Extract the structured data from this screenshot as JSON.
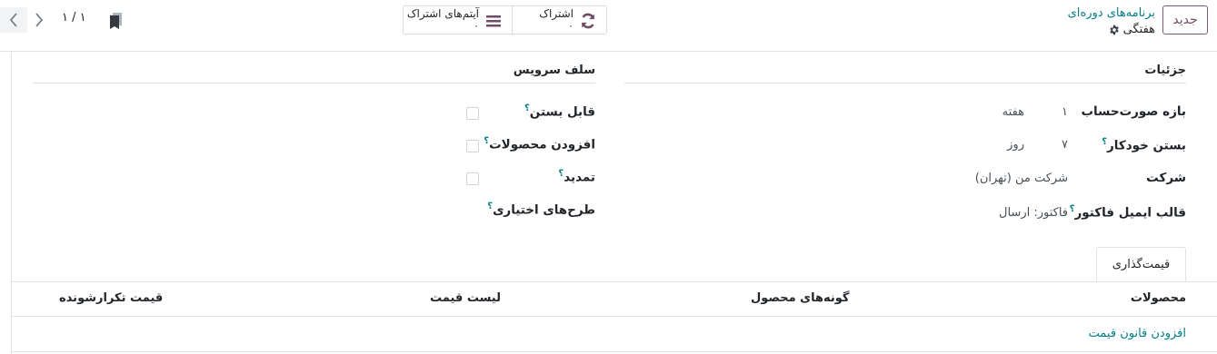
{
  "header": {
    "new_button": "جدید",
    "breadcrumb_parent": "برنامه‌های دوره‌ای",
    "breadcrumb_current": "هفتگی"
  },
  "smart_buttons": {
    "subscriptions": {
      "label": "اشتراک",
      "value": "۰"
    },
    "subscription_items": {
      "label": "آیتم‌های اشتراک",
      "value": "۰"
    }
  },
  "pager": {
    "value": "۱ / ۱"
  },
  "details": {
    "title": "جزئیات",
    "billing_period": {
      "label": "بازه صورت‌حساب",
      "number": "۱",
      "unit": "هفته"
    },
    "auto_close": {
      "label": "بستن خودکار",
      "help": "؟",
      "number": "۷",
      "unit": "روز"
    },
    "company": {
      "label": "شرکت",
      "value": "شرکت من (تهران)"
    },
    "invoice_email_template": {
      "label": "قالب ایمیل فاکتور",
      "help": "؟",
      "value": "فاکتور: ارسال"
    }
  },
  "self_service": {
    "title": "سلف سرویس",
    "closable": {
      "label": "قابل بستن",
      "help": "؟"
    },
    "add_products": {
      "label": "افزودن محصولات",
      "help": "؟"
    },
    "renew": {
      "label": "تمدید",
      "help": "؟"
    },
    "optional_plans": {
      "label": "طرح‌های اختیاری",
      "help": "؟"
    }
  },
  "tabs": {
    "pricing": "قیمت‌گذاری"
  },
  "pricing_table": {
    "columns": [
      "محصولات",
      "گونه‌های محصول",
      "لیست قیمت",
      "قیمت تکرارشونده"
    ],
    "add_line": "افزودن قانون قیمت"
  },
  "colors": {
    "primary": "#714b67",
    "link": "#017e84"
  }
}
